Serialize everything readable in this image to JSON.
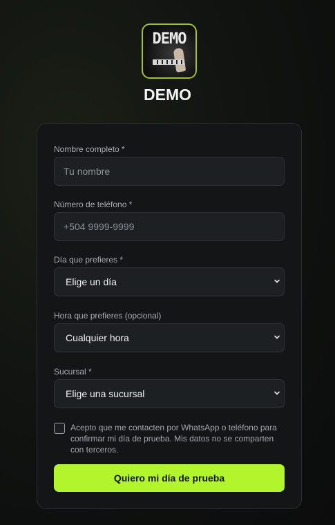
{
  "brand": {
    "logo_text": "DEMO",
    "title": "DEMO"
  },
  "form": {
    "name": {
      "label": "Nombre completo *",
      "placeholder": "Tu nombre"
    },
    "phone": {
      "label": "Número de teléfono *",
      "placeholder": "+504 9999-9999"
    },
    "day": {
      "label": "Día que prefieres *",
      "selected": "Elige un día"
    },
    "time": {
      "label": "Hora que prefieres (opcional)",
      "selected": "Cualquier hora"
    },
    "branch": {
      "label": "Sucursal *",
      "selected": "Elige una sucursal"
    },
    "consent": {
      "checked": false,
      "text": "Acepto que me contacten por WhatsApp o teléfono para confirmar mi día de prueba. Mis datos no se comparten con terceros."
    },
    "submit_label": "Quiero mi día de prueba"
  },
  "colors": {
    "accent": "#b3f52c",
    "card_bg": "#131517",
    "field_bg": "#1d2023"
  },
  "icons": {
    "select_arrow": "chevron-down-icon",
    "checkbox": "checkbox-icon"
  }
}
